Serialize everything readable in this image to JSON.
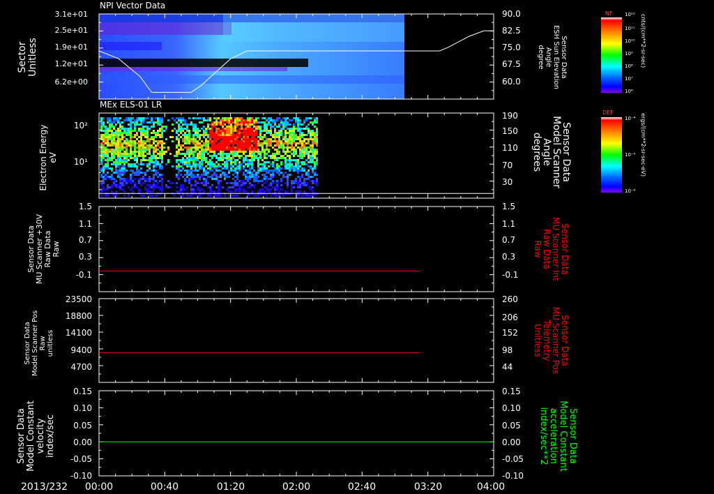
{
  "colors": {
    "background": "#000000",
    "axes": "#ffffff",
    "red_trace": "#ff0000",
    "green_trace": "#00ff00",
    "right_label_red": "#ff0000",
    "right_label_green": "#00ff00",
    "colormap": [
      "#ffffff",
      "#ff0000",
      "#ff8800",
      "#ffff00",
      "#00ff00",
      "#00ffff",
      "#0088ff",
      "#0000ff",
      "#8800ff"
    ]
  },
  "date_label": "2013/232",
  "time_axis": {
    "range_minutes": [
      0,
      240
    ],
    "ticks": [
      "00:00",
      "00:40",
      "01:20",
      "02:00",
      "02:40",
      "03:20",
      "04:00"
    ]
  },
  "colorbars": [
    {
      "title": "NF",
      "unit": "cnts/(cm**2-sr-sec)",
      "ticks": [
        "10¹²",
        "10¹¹",
        "10¹⁰",
        "10⁹",
        "10⁸",
        "10⁷",
        "10⁶"
      ]
    },
    {
      "title": "DEF",
      "unit": "ergs/(cm**2-sr-sec-eV)",
      "ticks": [
        "10⁻⁴",
        "10⁻⁵",
        "10⁻⁶"
      ]
    }
  ],
  "chart_data": [
    {
      "type": "heatmap",
      "title": "NPI Vector Data",
      "ylabel": [
        "Sector",
        "Unitless"
      ],
      "yticks": [
        "3.1e+01",
        "2.5e+01",
        "1.9e+01",
        "1.2e+01",
        "6.2e+00"
      ],
      "y2label": [
        "Sensor Data",
        "ESH Sun Elevation",
        "Angle",
        "degree"
      ],
      "y2ticks": [
        "90.0",
        "82.5",
        "75.0",
        "67.5",
        "60.0"
      ],
      "y2lim": [
        52,
        90
      ],
      "data_end_minutes": 186,
      "overlay_line": {
        "name": "ESH Sun Elevation Angle",
        "x": [
          0,
          12,
          25,
          32,
          56,
          62,
          68,
          80,
          90,
          120,
          200,
          207,
          212,
          225,
          234,
          240
        ],
        "y": [
          73.5,
          70,
          62,
          55,
          55,
          58,
          62,
          70,
          73.5,
          73.5,
          73.5,
          73.5,
          75,
          80,
          82.5,
          82.5
        ]
      }
    },
    {
      "type": "heatmap",
      "title": "MEx ELS-01 LR",
      "ylabel": [
        "Electron Energy",
        "eV"
      ],
      "yticks": [
        "10²",
        "10¹"
      ],
      "y2label": [
        "Sensor Data",
        "Model Scanner",
        "Angle",
        "degrees"
      ],
      "y2ticks": [
        "190",
        "150",
        "110",
        "70",
        "30"
      ],
      "y2lim": [
        10,
        190
      ],
      "data_end_minutes": 132,
      "overlay_line": {
        "name": "Model Scanner Angle",
        "x": [
          0,
          240
        ],
        "y": [
          20,
          20
        ]
      }
    },
    {
      "type": "line",
      "ylabel": [
        "Sensor Data",
        "MU Scanner +30V",
        "Raw Data",
        "Raw"
      ],
      "yticks": [
        "1.5",
        "1.1",
        "0.7",
        "0.3",
        "-0.1"
      ],
      "ylim": [
        -0.35,
        1.5
      ],
      "y2label": [
        "Sensor Data",
        "MU Scanner Int",
        "Raw Data",
        "Raw"
      ],
      "y2ticks": [
        "1.5",
        "1.1",
        "0.7",
        "0.3",
        "-0.1"
      ],
      "series": [
        {
          "color": "#ff0000",
          "x": [
            0,
            195
          ],
          "y": [
            0.1,
            0.1
          ]
        }
      ]
    },
    {
      "type": "line",
      "ylabel": [
        "Sensor Data",
        "Model Scanner Pos",
        "Raw",
        "unitless"
      ],
      "yticks": [
        "23500",
        "18800",
        "14100",
        "9400",
        "4700"
      ],
      "ylim": [
        0,
        23500
      ],
      "y2label": [
        "Sensor Data",
        "MU Scanner Pos",
        "Telemetry",
        "Unitless"
      ],
      "y2ticks": [
        "260",
        "206",
        "152",
        "98",
        "44"
      ],
      "series": [
        {
          "color": "#ff0000",
          "x": [
            0,
            195
          ],
          "y": [
            8300,
            8300
          ]
        }
      ]
    },
    {
      "type": "line",
      "ylabel": [
        "Sensor Data",
        "Model Constant",
        "velocity",
        "index/sec"
      ],
      "yticks": [
        "0.15",
        "0.10",
        "0.05",
        "0.00",
        "-0.05",
        "-0.10"
      ],
      "ylim": [
        -0.1,
        0.15
      ],
      "y2label": [
        "Sensor Data",
        "Model Constant",
        "acceleration",
        "index/sec**2"
      ],
      "y2ticks": [
        "0.15",
        "0.10",
        "0.05",
        "0.00",
        "-0.05",
        "-0.10"
      ],
      "series": [
        {
          "color": "#00ff00",
          "x": [
            0,
            240
          ],
          "y": [
            0,
            0
          ]
        }
      ]
    }
  ]
}
